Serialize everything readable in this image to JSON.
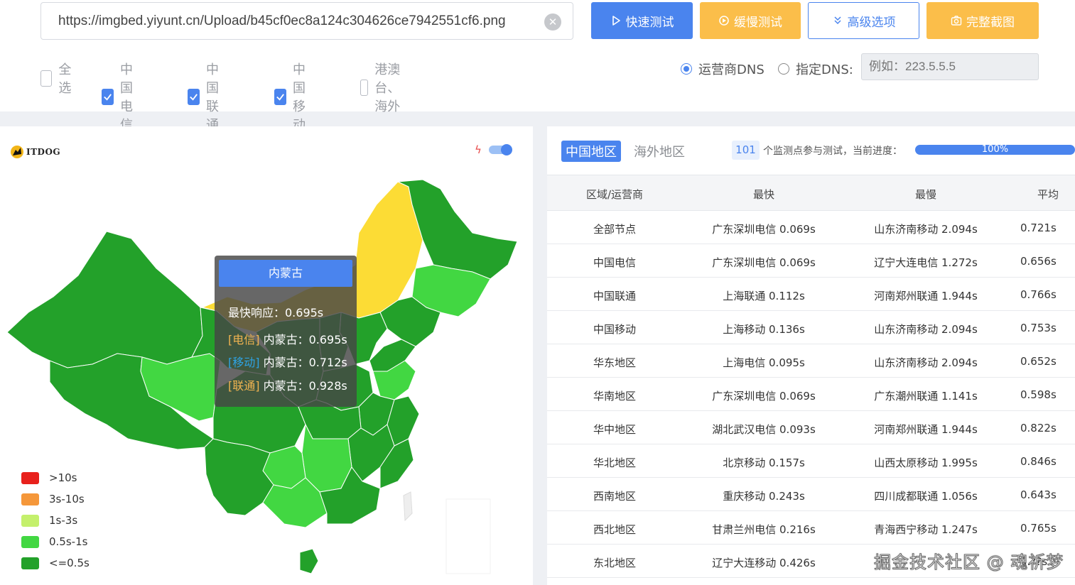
{
  "url": {
    "value": "https://imgbed.yiyunt.cn/Upload/b45cf0ec8a124c304626ce7942551cf6.png",
    "clear_icon": "close-circle-icon"
  },
  "buttons": {
    "quick": {
      "label": "快速测试",
      "icon": "play-icon",
      "color": "#4a84ee"
    },
    "slow": {
      "label": "缓慢测试",
      "icon": "target-icon",
      "color": "#fbbe4a"
    },
    "advanced": {
      "label": "高级选项",
      "icon": "double-chevron-down-icon"
    },
    "screenshot": {
      "label": "完整截图",
      "icon": "camera-icon"
    }
  },
  "filters": [
    {
      "label": "全选",
      "checked": false
    },
    {
      "label": "中国电信",
      "checked": true
    },
    {
      "label": "中国联通",
      "checked": true
    },
    {
      "label": "中国移动",
      "checked": true
    },
    {
      "label": "港澳台、海外",
      "checked": false
    }
  ],
  "dns": {
    "operator_label": "运营商DNS",
    "operator_selected": true,
    "custom_label": "指定DNS:",
    "custom_selected": false,
    "placeholder": "例如：223.5.5.5"
  },
  "map": {
    "logo_text": "ITDOG",
    "toggle_on": true,
    "legend": [
      {
        "label": ">10s",
        "color": "#e8211c"
      },
      {
        "label": "3s-10s",
        "color": "#f5973a"
      },
      {
        "label": "1s-3s",
        "color": "#c4f06c"
      },
      {
        "label": "0.5s-1s",
        "color": "#42d742"
      },
      {
        "label": "<=0.5s",
        "color": "#23a12a"
      }
    ],
    "tooltip": {
      "title": "内蒙古",
      "fastest": "最快响应：0.695s",
      "lines": [
        {
          "tag": "[电信]",
          "text": " 内蒙古：0.695s"
        },
        {
          "tag": "[移动]",
          "text": " 内蒙古：0.712s"
        },
        {
          "tag": "[联通]",
          "text": " 内蒙古：0.928s"
        }
      ]
    }
  },
  "results": {
    "tabs": [
      {
        "label": "中国地区",
        "active": true
      },
      {
        "label": "海外地区",
        "active": false
      }
    ],
    "node_count": "101",
    "count_text": "个监测点参与测试，当前进度：",
    "progress": "100%",
    "progress_value": 100,
    "headers": [
      "区域/运营商",
      "最快",
      "最慢",
      "平均"
    ],
    "rows": [
      [
        "全部节点",
        "广东深圳电信 0.069s",
        "山东济南移动 2.094s",
        "0.721s"
      ],
      [
        "中国电信",
        "广东深圳电信 0.069s",
        "辽宁大连电信 1.272s",
        "0.656s"
      ],
      [
        "中国联通",
        "上海联通 0.112s",
        "河南郑州联通 1.944s",
        "0.766s"
      ],
      [
        "中国移动",
        "上海移动 0.136s",
        "山东济南移动 2.094s",
        "0.753s"
      ],
      [
        "华东地区",
        "上海电信 0.095s",
        "山东济南移动 2.094s",
        "0.652s"
      ],
      [
        "华南地区",
        "广东深圳电信 0.069s",
        "广东潮州联通 1.141s",
        "0.598s"
      ],
      [
        "华中地区",
        "湖北武汉电信 0.093s",
        "河南郑州联通 1.944s",
        "0.822s"
      ],
      [
        "华北地区",
        "北京移动 0.157s",
        "山西太原移动 1.995s",
        "0.846s"
      ],
      [
        "西南地区",
        "重庆移动 0.243s",
        "四川成都联通 1.056s",
        "0.643s"
      ],
      [
        "西北地区",
        "甘肃兰州电信 0.216s",
        "青海西宁移动 1.247s",
        "0.765s"
      ],
      [
        "东北地区",
        "辽宁大连移动 0.426s",
        "",
        "0.??s"
      ]
    ]
  },
  "watermark": "掘金技术社区 @ 魂祈梦"
}
